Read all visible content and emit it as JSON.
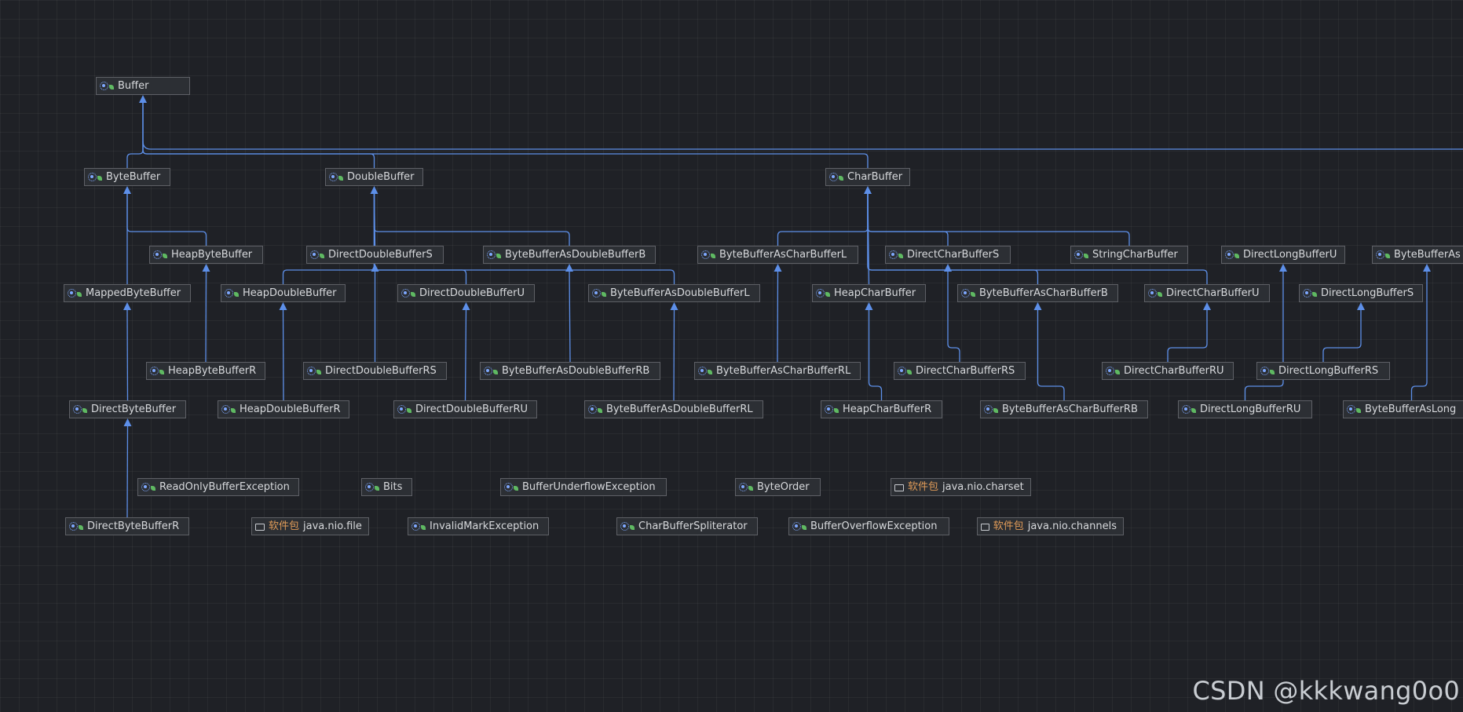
{
  "diagram": {
    "nodes": [
      {
        "id": "buffer",
        "label": "Buffer",
        "kind": "class"
      },
      {
        "id": "bytebuffer",
        "label": "ByteBuffer",
        "kind": "class"
      },
      {
        "id": "doublebuffer",
        "label": "DoubleBuffer",
        "kind": "class"
      },
      {
        "id": "charbuffer",
        "label": "CharBuffer",
        "kind": "class"
      },
      {
        "id": "heapbytebuffer",
        "label": "HeapByteBuffer",
        "kind": "class"
      },
      {
        "id": "directdoublebuffers",
        "label": "DirectDoubleBufferS",
        "kind": "class"
      },
      {
        "id": "bbasdoublebufferb",
        "label": "ByteBufferAsDoubleBufferB",
        "kind": "class"
      },
      {
        "id": "bbascharbufferl",
        "label": "ByteBufferAsCharBufferL",
        "kind": "class"
      },
      {
        "id": "directcharbuffers",
        "label": "DirectCharBufferS",
        "kind": "class"
      },
      {
        "id": "stringcharbuffer",
        "label": "StringCharBuffer",
        "kind": "class"
      },
      {
        "id": "directlongbufferu",
        "label": "DirectLongBufferU",
        "kind": "class"
      },
      {
        "id": "bbasl_top",
        "label": "ByteBufferAs",
        "kind": "class"
      },
      {
        "id": "mappedbytebuffer",
        "label": "MappedByteBuffer",
        "kind": "class"
      },
      {
        "id": "heapdoublebuffer",
        "label": "HeapDoubleBuffer",
        "kind": "class"
      },
      {
        "id": "directdoublebufferu",
        "label": "DirectDoubleBufferU",
        "kind": "class"
      },
      {
        "id": "bbasdoublebufferl",
        "label": "ByteBufferAsDoubleBufferL",
        "kind": "class"
      },
      {
        "id": "heapcharbuffer",
        "label": "HeapCharBuffer",
        "kind": "class"
      },
      {
        "id": "bbascharbufferb",
        "label": "ByteBufferAsCharBufferB",
        "kind": "class"
      },
      {
        "id": "directcharbufferu",
        "label": "DirectCharBufferU",
        "kind": "class"
      },
      {
        "id": "directlongbuffers",
        "label": "DirectLongBufferS",
        "kind": "class"
      },
      {
        "id": "heapbytebufferr",
        "label": "HeapByteBufferR",
        "kind": "class"
      },
      {
        "id": "directdoublebufferrs",
        "label": "DirectDoubleBufferRS",
        "kind": "class"
      },
      {
        "id": "bbasdoublebufferrb",
        "label": "ByteBufferAsDoubleBufferRB",
        "kind": "class"
      },
      {
        "id": "bbascharbufferrl",
        "label": "ByteBufferAsCharBufferRL",
        "kind": "class"
      },
      {
        "id": "directcharbufferrs",
        "label": "DirectCharBufferRS",
        "kind": "class"
      },
      {
        "id": "directcharbufferru",
        "label": "DirectCharBufferRU",
        "kind": "class"
      },
      {
        "id": "directlongbufferrs",
        "label": "DirectLongBufferRS",
        "kind": "class"
      },
      {
        "id": "directbytebuffer",
        "label": "DirectByteBuffer",
        "kind": "class"
      },
      {
        "id": "heapdoublebufferr",
        "label": "HeapDoubleBufferR",
        "kind": "class"
      },
      {
        "id": "directdoublebufferru",
        "label": "DirectDoubleBufferRU",
        "kind": "class"
      },
      {
        "id": "bbasdoublebufferrl",
        "label": "ByteBufferAsDoubleBufferRL",
        "kind": "class"
      },
      {
        "id": "heapcharbufferr",
        "label": "HeapCharBufferR",
        "kind": "class"
      },
      {
        "id": "bbascharbufferrb",
        "label": "ByteBufferAsCharBufferRB",
        "kind": "class"
      },
      {
        "id": "directlongbufferru",
        "label": "DirectLongBufferRU",
        "kind": "class"
      },
      {
        "id": "bbaslong_bottom",
        "label": "ByteBufferAsLong",
        "kind": "class"
      },
      {
        "id": "readonlybufferexception",
        "label": "ReadOnlyBufferException",
        "kind": "class"
      },
      {
        "id": "bits",
        "label": "Bits",
        "kind": "class"
      },
      {
        "id": "bufferunderflowexception",
        "label": "BufferUnderflowException",
        "kind": "class"
      },
      {
        "id": "byteorder",
        "label": "ByteOrder",
        "kind": "class"
      },
      {
        "id": "pkg_charset",
        "label": "java.nio.charset",
        "kind": "package",
        "prefix": "软件包"
      },
      {
        "id": "directbytebufferr",
        "label": "DirectByteBufferR",
        "kind": "class"
      },
      {
        "id": "pkg_file",
        "label": "java.nio.file",
        "kind": "package",
        "prefix": "软件包"
      },
      {
        "id": "invalidmarkexception",
        "label": "InvalidMarkException",
        "kind": "class"
      },
      {
        "id": "charbufferspliterator",
        "label": "CharBufferSpliterator",
        "kind": "class"
      },
      {
        "id": "bufferoverflowexception",
        "label": "BufferOverflowException",
        "kind": "class"
      },
      {
        "id": "pkg_channels",
        "label": "java.nio.channels",
        "kind": "package",
        "prefix": "软件包"
      }
    ],
    "edges": [
      {
        "from": "bytebuffer",
        "to": "buffer"
      },
      {
        "from": "doublebuffer",
        "to": "buffer"
      },
      {
        "from": "charbuffer",
        "to": "buffer"
      },
      {
        "from": "mappedbytebuffer",
        "to": "bytebuffer"
      },
      {
        "from": "heapbytebuffer",
        "to": "bytebuffer"
      },
      {
        "from": "directbytebuffer",
        "to": "mappedbytebuffer"
      },
      {
        "from": "heapbytebufferr",
        "to": "heapbytebuffer"
      },
      {
        "from": "directbytebufferr",
        "to": "directbytebuffer"
      },
      {
        "from": "heapdoublebuffer",
        "to": "doublebuffer"
      },
      {
        "from": "directdoublebuffers",
        "to": "doublebuffer"
      },
      {
        "from": "directdoublebufferu",
        "to": "doublebuffer"
      },
      {
        "from": "bbasdoublebufferb",
        "to": "doublebuffer"
      },
      {
        "from": "bbasdoublebufferl",
        "to": "doublebuffer"
      },
      {
        "from": "heapdoublebufferr",
        "to": "heapdoublebuffer"
      },
      {
        "from": "directdoublebufferrs",
        "to": "directdoublebuffers"
      },
      {
        "from": "directdoublebufferru",
        "to": "directdoublebufferu"
      },
      {
        "from": "bbasdoublebufferrb",
        "to": "bbasdoublebufferb"
      },
      {
        "from": "bbasdoublebufferrl",
        "to": "bbasdoublebufferl"
      },
      {
        "from": "bbascharbufferl",
        "to": "charbuffer"
      },
      {
        "from": "heapcharbuffer",
        "to": "charbuffer"
      },
      {
        "from": "directcharbuffers",
        "to": "charbuffer"
      },
      {
        "from": "bbascharbufferb",
        "to": "charbuffer"
      },
      {
        "from": "stringcharbuffer",
        "to": "charbuffer"
      },
      {
        "from": "directcharbufferu",
        "to": "charbuffer"
      },
      {
        "from": "bbascharbufferrl",
        "to": "bbascharbufferl"
      },
      {
        "from": "heapcharbufferr",
        "to": "heapcharbuffer"
      },
      {
        "from": "directcharbufferrs",
        "to": "directcharbuffers"
      },
      {
        "from": "bbascharbufferrb",
        "to": "bbascharbufferb"
      },
      {
        "from": "directcharbufferru",
        "to": "directcharbufferu"
      },
      {
        "from": "directlongbufferru",
        "to": "directlongbufferu"
      },
      {
        "from": "directlongbufferrs",
        "to": "directlongbuffers"
      },
      {
        "from": "bbaslong_bottom",
        "to": "bbasl_top"
      }
    ]
  },
  "watermark": "CSDN @kkkwang0o0"
}
